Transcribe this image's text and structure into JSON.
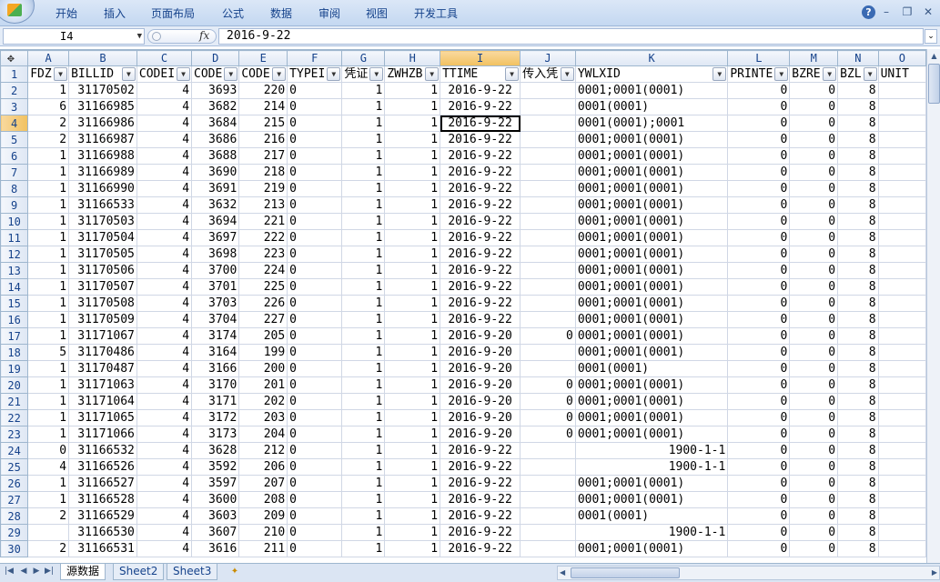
{
  "ribbon": {
    "tabs": [
      "开始",
      "插入",
      "页面布局",
      "公式",
      "数据",
      "审阅",
      "视图",
      "开发工具"
    ],
    "help": "?",
    "minimize": "–",
    "restore": "❐",
    "close": "✕"
  },
  "formula_bar": {
    "name_box": "I4",
    "fx": "fx",
    "value": "2016-9-22"
  },
  "grid": {
    "columns": [
      "A",
      "B",
      "C",
      "D",
      "E",
      "F",
      "G",
      "H",
      "I",
      "J",
      "K",
      "L",
      "M",
      "N",
      "O"
    ],
    "selected_column": "I",
    "selected_row": "4",
    "active_cell": "I4",
    "headers": [
      "FDZ",
      "BILLID",
      "CODEI",
      "CODE",
      "CODE",
      "TYPEI",
      "凭证",
      "ZWHZB",
      "TTIME",
      "传入凭",
      "YWLXID",
      "PRINTE",
      "BZRE",
      "BZL",
      "UNIT"
    ],
    "rows": [
      [
        "2",
        "1",
        "31170502",
        "4",
        "3693",
        "220",
        "0",
        "1",
        "1",
        "2016-9-22",
        "",
        "0001;0001(0001)",
        "0",
        "0",
        "8",
        ""
      ],
      [
        "3",
        "6",
        "31166985",
        "4",
        "3682",
        "214",
        "0",
        "1",
        "1",
        "2016-9-22",
        "",
        "0001(0001)",
        "0",
        "0",
        "8",
        ""
      ],
      [
        "4",
        "2",
        "31166986",
        "4",
        "3684",
        "215",
        "0",
        "1",
        "1",
        "2016-9-22",
        "",
        "0001(0001);0001",
        "0",
        "0",
        "8",
        ""
      ],
      [
        "5",
        "2",
        "31166987",
        "4",
        "3686",
        "216",
        "0",
        "1",
        "1",
        "2016-9-22",
        "",
        "0001;0001(0001)",
        "0",
        "0",
        "8",
        ""
      ],
      [
        "6",
        "1",
        "31166988",
        "4",
        "3688",
        "217",
        "0",
        "1",
        "1",
        "2016-9-22",
        "",
        "0001;0001(0001)",
        "0",
        "0",
        "8",
        ""
      ],
      [
        "7",
        "1",
        "31166989",
        "4",
        "3690",
        "218",
        "0",
        "1",
        "1",
        "2016-9-22",
        "",
        "0001;0001(0001)",
        "0",
        "0",
        "8",
        ""
      ],
      [
        "8",
        "1",
        "31166990",
        "4",
        "3691",
        "219",
        "0",
        "1",
        "1",
        "2016-9-22",
        "",
        "0001;0001(0001)",
        "0",
        "0",
        "8",
        ""
      ],
      [
        "9",
        "1",
        "31166533",
        "4",
        "3632",
        "213",
        "0",
        "1",
        "1",
        "2016-9-22",
        "",
        "0001;0001(0001)",
        "0",
        "0",
        "8",
        ""
      ],
      [
        "10",
        "1",
        "31170503",
        "4",
        "3694",
        "221",
        "0",
        "1",
        "1",
        "2016-9-22",
        "",
        "0001;0001(0001)",
        "0",
        "0",
        "8",
        ""
      ],
      [
        "11",
        "1",
        "31170504",
        "4",
        "3697",
        "222",
        "0",
        "1",
        "1",
        "2016-9-22",
        "",
        "0001;0001(0001)",
        "0",
        "0",
        "8",
        ""
      ],
      [
        "12",
        "1",
        "31170505",
        "4",
        "3698",
        "223",
        "0",
        "1",
        "1",
        "2016-9-22",
        "",
        "0001;0001(0001)",
        "0",
        "0",
        "8",
        ""
      ],
      [
        "13",
        "1",
        "31170506",
        "4",
        "3700",
        "224",
        "0",
        "1",
        "1",
        "2016-9-22",
        "",
        "0001;0001(0001)",
        "0",
        "0",
        "8",
        ""
      ],
      [
        "14",
        "1",
        "31170507",
        "4",
        "3701",
        "225",
        "0",
        "1",
        "1",
        "2016-9-22",
        "",
        "0001;0001(0001)",
        "0",
        "0",
        "8",
        ""
      ],
      [
        "15",
        "1",
        "31170508",
        "4",
        "3703",
        "226",
        "0",
        "1",
        "1",
        "2016-9-22",
        "",
        "0001;0001(0001)",
        "0",
        "0",
        "8",
        ""
      ],
      [
        "16",
        "1",
        "31170509",
        "4",
        "3704",
        "227",
        "0",
        "1",
        "1",
        "2016-9-22",
        "",
        "0001;0001(0001)",
        "0",
        "0",
        "8",
        ""
      ],
      [
        "17",
        "1",
        "31171067",
        "4",
        "3174",
        "205",
        "0",
        "1",
        "1",
        "2016-9-20",
        "0",
        "0001;0001(0001)",
        "0",
        "0",
        "8",
        ""
      ],
      [
        "18",
        "5",
        "31170486",
        "4",
        "3164",
        "199",
        "0",
        "1",
        "1",
        "2016-9-20",
        "",
        "0001;0001(0001)",
        "0",
        "0",
        "8",
        ""
      ],
      [
        "19",
        "1",
        "31170487",
        "4",
        "3166",
        "200",
        "0",
        "1",
        "1",
        "2016-9-20",
        "",
        "0001(0001)",
        "0",
        "0",
        "8",
        ""
      ],
      [
        "20",
        "1",
        "31171063",
        "4",
        "3170",
        "201",
        "0",
        "1",
        "1",
        "2016-9-20",
        "0",
        "0001;0001(0001)",
        "0",
        "0",
        "8",
        ""
      ],
      [
        "21",
        "1",
        "31171064",
        "4",
        "3171",
        "202",
        "0",
        "1",
        "1",
        "2016-9-20",
        "0",
        "0001;0001(0001)",
        "0",
        "0",
        "8",
        ""
      ],
      [
        "22",
        "1",
        "31171065",
        "4",
        "3172",
        "203",
        "0",
        "1",
        "1",
        "2016-9-20",
        "0",
        "0001;0001(0001)",
        "0",
        "0",
        "8",
        ""
      ],
      [
        "23",
        "1",
        "31171066",
        "4",
        "3173",
        "204",
        "0",
        "1",
        "1",
        "2016-9-20",
        "0",
        "0001;0001(0001)",
        "0",
        "0",
        "8",
        ""
      ],
      [
        "24",
        "0",
        "31166532",
        "4",
        "3628",
        "212",
        "0",
        "1",
        "1",
        "2016-9-22",
        "",
        "1900-1-1",
        "0",
        "0",
        "8",
        ""
      ],
      [
        "25",
        "4",
        "31166526",
        "4",
        "3592",
        "206",
        "0",
        "1",
        "1",
        "2016-9-22",
        "",
        "1900-1-1",
        "0",
        "0",
        "8",
        ""
      ],
      [
        "26",
        "1",
        "31166527",
        "4",
        "3597",
        "207",
        "0",
        "1",
        "1",
        "2016-9-22",
        "",
        "0001;0001(0001)",
        "0",
        "0",
        "8",
        ""
      ],
      [
        "27",
        "1",
        "31166528",
        "4",
        "3600",
        "208",
        "0",
        "1",
        "1",
        "2016-9-22",
        "",
        "0001;0001(0001)",
        "0",
        "0",
        "8",
        ""
      ],
      [
        "28",
        "2",
        "31166529",
        "4",
        "3603",
        "209",
        "0",
        "1",
        "1",
        "2016-9-22",
        "",
        "0001(0001)",
        "0",
        "0",
        "8",
        ""
      ],
      [
        "29",
        "",
        "31166530",
        "4",
        "3607",
        "210",
        "0",
        "1",
        "1",
        "2016-9-22",
        "",
        "1900-1-1",
        "0",
        "0",
        "8",
        ""
      ],
      [
        "30",
        "2",
        "31166531",
        "4",
        "3616",
        "211",
        "0",
        "1",
        "1",
        "2016-9-22",
        "",
        "0001;0001(0001)",
        "0",
        "0",
        "8",
        ""
      ]
    ]
  },
  "sheets": {
    "tabs": [
      "源数据",
      "Sheet2",
      "Sheet3"
    ],
    "active": "源数据"
  }
}
